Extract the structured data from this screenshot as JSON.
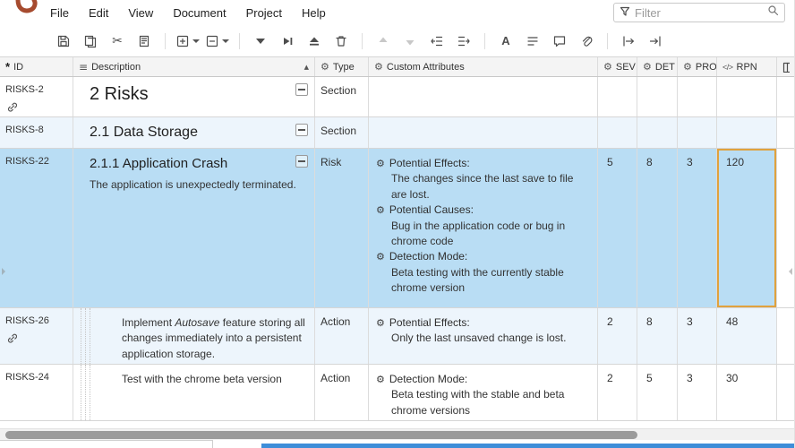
{
  "app": {
    "menu": [
      "File",
      "Edit",
      "View",
      "Document",
      "Project",
      "Help"
    ],
    "filter_placeholder": "Filter"
  },
  "icons": {
    "scissors": "✂",
    "gear": "⚙",
    "asterisk": "*",
    "code": "</>",
    "sort_asc": "▲",
    "lines": "≡",
    "letter_a": "A"
  },
  "header": {
    "id": "ID",
    "description": "Description",
    "type": "Type",
    "custom": "Custom Attributes",
    "sev": "SEV",
    "det": "DET",
    "prob": "PROB",
    "rpn": "RPN"
  },
  "rows": {
    "r1": {
      "id": "RISKS-2",
      "title": "2 Risks",
      "type": "Section"
    },
    "r2": {
      "id": "RISKS-8",
      "title": "2.1 Data Storage",
      "type": "Section"
    },
    "r3": {
      "id": "RISKS-22",
      "title": "2.1.1 Application Crash",
      "body": "The application is unexpectedly terminated.",
      "type": "Risk",
      "attr1_label": "Potential Effects:",
      "attr1_text": "The changes since the last save to file are lost.",
      "attr2_label": "Potential Causes:",
      "attr2_text": "Bug in the application code or bug in chrome code",
      "attr3_label": "Detection Mode:",
      "attr3_text": "Beta testing with the currently stable chrome version",
      "sev": "5",
      "det": "8",
      "prob": "3",
      "rpn": "120"
    },
    "r4": {
      "id": "RISKS-26",
      "desc_pre": "Implement ",
      "desc_italic": "Autosave",
      "desc_post": " feature storing all changes immediately into a persistent application storage.",
      "type": "Action",
      "attr1_label": "Potential Effects:",
      "attr1_text": "Only the last unsaved change is lost.",
      "sev": "2",
      "det": "8",
      "prob": "3",
      "rpn": "48"
    },
    "r5": {
      "id": "RISKS-24",
      "desc": "Test with the chrome beta version",
      "type": "Action",
      "attr1_label": "Detection Mode:",
      "attr1_text": "Beta testing with the stable and beta chrome versions",
      "sev": "2",
      "det": "5",
      "prob": "3",
      "rpn": "30"
    }
  }
}
